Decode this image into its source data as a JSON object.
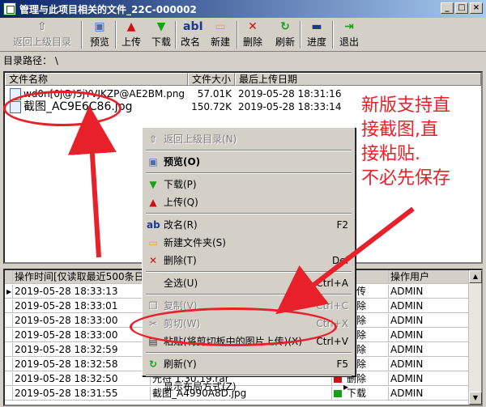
{
  "window": {
    "title": "管理与此项目相关的文件_22C-000002",
    "min": "_",
    "max": "□",
    "close": "×"
  },
  "toolbar": [
    {
      "label": "返回上级目录",
      "icon": "folder-up-icon",
      "glyph": "⇧",
      "color": "#808080",
      "disabled": true
    },
    {
      "label": "预览",
      "icon": "preview-icon",
      "glyph": "▣",
      "color": "#4a6fa5"
    },
    {
      "label": "上传",
      "icon": "upload-arrow-icon",
      "glyph": "▲",
      "color": "#d01010"
    },
    {
      "label": "下载",
      "icon": "download-arrow-icon",
      "glyph": "▼",
      "color": "#18a018"
    },
    {
      "label": "改名",
      "icon": "rename-icon",
      "glyph": "abI",
      "color": "#1c3a8a"
    },
    {
      "label": "新建",
      "icon": "new-folder-icon",
      "glyph": "▭",
      "color": "#e0a020"
    },
    {
      "label": "删除",
      "icon": "delete-x-icon",
      "glyph": "✕",
      "color": "#d01010"
    },
    {
      "label": "刷新",
      "icon": "refresh-icon",
      "glyph": "↻",
      "color": "#18a018"
    },
    {
      "label": "进度",
      "icon": "progress-icon",
      "glyph": "▬",
      "color": "#1c3a8a"
    },
    {
      "label": "退出",
      "icon": "exit-door-icon",
      "glyph": "⇥",
      "color": "#18a018"
    }
  ],
  "path": {
    "label": "目录路径：",
    "value": "\\"
  },
  "files": {
    "headers": [
      "文件名称",
      "文件大小",
      "最后上传日期"
    ],
    "rows": [
      {
        "name": "wd0n[0j@)5jYVJKZP@AE2BM.png",
        "size": "57.01K",
        "date": "2019-05-28 18:31:16"
      },
      {
        "name": "截图_AC9E6C86.jpg",
        "size": "150.72K",
        "date": "2019-05-28 18:33:14"
      }
    ]
  },
  "log": {
    "headers": [
      "操作时间[仅读取最近500条日",
      "",
      "类型",
      "操作用户"
    ],
    "rows": [
      {
        "time": "2019-05-28 18:33:13",
        "file": "",
        "type": "上传",
        "user": "ADMIN"
      },
      {
        "time": "2019-05-28 18:33:01",
        "file": "",
        "type": "删除",
        "user": "ADMIN"
      },
      {
        "time": "2019-05-28 18:33:00",
        "file": "",
        "type": "删除",
        "user": "ADMIN"
      },
      {
        "time": "2019-05-28 18:33:00",
        "file": "",
        "type": "删除",
        "user": "ADMIN"
      },
      {
        "time": "2019-05-28 18:32:59",
        "file": "",
        "type": "删除",
        "user": "ADMIN"
      },
      {
        "time": "2019-05-28 18:32:58",
        "file": "",
        "type": "删除",
        "user": "ADMIN"
      },
      {
        "time": "2019-05-28 18:32:50",
        "file": "光符 1.30.19.rar",
        "type": "删除",
        "user": "ADMIN"
      },
      {
        "time": "2019-05-28 18:31:55",
        "file": "截图_A4990A8D.jpg",
        "type": "下载",
        "user": "ADMIN"
      }
    ]
  },
  "menu": [
    {
      "type": "item",
      "label": "返回上级目录(N)",
      "shortcut": "",
      "icon": "folder-up-icon",
      "glyph": "⇧",
      "color": "#808080",
      "disabled": true
    },
    {
      "type": "sep"
    },
    {
      "type": "item",
      "label": "预览(O)",
      "shortcut": "",
      "icon": "preview-icon",
      "glyph": "▣",
      "color": "#4a6fa5",
      "bold": true
    },
    {
      "type": "sep"
    },
    {
      "type": "item",
      "label": "下载(P)",
      "shortcut": "",
      "icon": "download-arrow-icon",
      "glyph": "▼",
      "color": "#18a018"
    },
    {
      "type": "item",
      "label": "上传(Q)",
      "shortcut": "",
      "icon": "upload-arrow-icon",
      "glyph": "▲",
      "color": "#d01010"
    },
    {
      "type": "sep"
    },
    {
      "type": "item",
      "label": "改名(R)",
      "shortcut": "F2",
      "icon": "rename-icon",
      "glyph": "ab",
      "color": "#1c3a8a"
    },
    {
      "type": "item",
      "label": "新建文件夹(S)",
      "shortcut": "",
      "icon": "new-folder-icon",
      "glyph": "▭",
      "color": "#e0a020"
    },
    {
      "type": "item",
      "label": "删除(T)",
      "shortcut": "Del",
      "icon": "delete-x-icon",
      "glyph": "✕",
      "color": "#d01010"
    },
    {
      "type": "sep"
    },
    {
      "type": "item",
      "label": "全选(U)",
      "shortcut": "Ctrl+A",
      "icon": "",
      "glyph": "",
      "color": "#000"
    },
    {
      "type": "sep"
    },
    {
      "type": "item",
      "label": "复制(V)",
      "shortcut": "Ctrl+C",
      "icon": "copy-icon",
      "glyph": "❐",
      "color": "#808080",
      "disabled": true
    },
    {
      "type": "item",
      "label": "剪切(W)",
      "shortcut": "Ctrl+X",
      "icon": "cut-scissors-icon",
      "glyph": "✂",
      "color": "#808080",
      "disabled": true
    },
    {
      "type": "item",
      "label": "粘贴(将剪切板中的图片上传)(X)",
      "shortcut": "Ctrl+V",
      "icon": "paste-icon",
      "glyph": "▤",
      "color": "#404040"
    },
    {
      "type": "sep"
    },
    {
      "type": "item",
      "label": "刷新(Y)",
      "shortcut": "F5",
      "icon": "refresh-icon",
      "glyph": "↻",
      "color": "#18a018"
    },
    {
      "type": "sep"
    },
    {
      "type": "item",
      "label": "显示布局方式(Z)",
      "shortcut": "▸",
      "icon": "",
      "glyph": "",
      "color": "#000"
    }
  ],
  "annotation": {
    "lines": [
      "新版支持直",
      "接截图,直",
      "接粘贴.",
      "不必先保存"
    ],
    "color": "#e8202a"
  }
}
